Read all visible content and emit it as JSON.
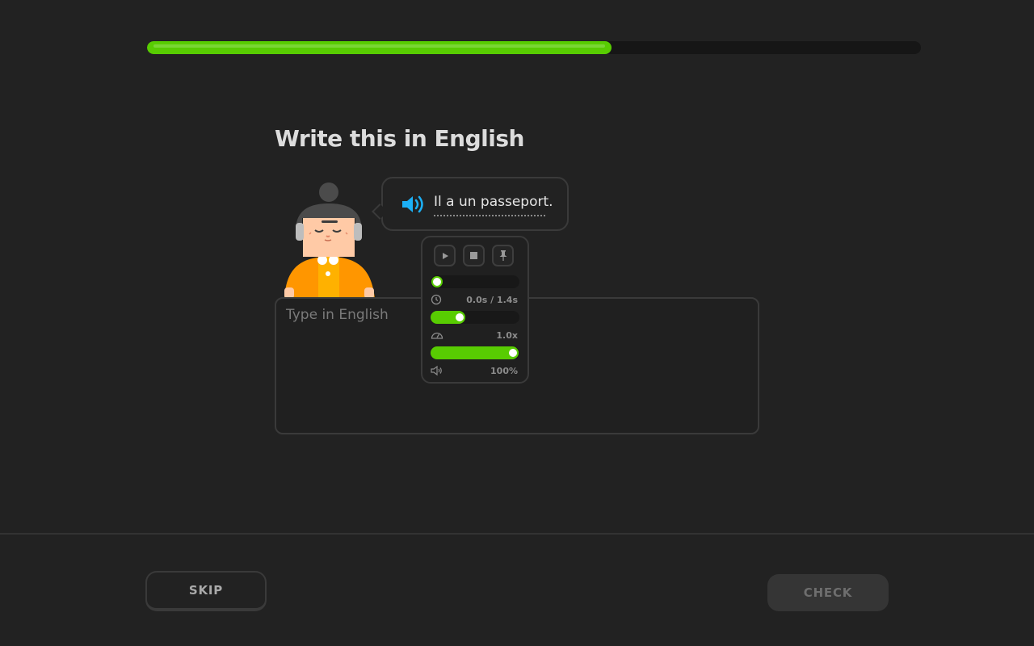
{
  "progress": {
    "fraction": 0.6,
    "color": "#58cc02"
  },
  "lesson": {
    "title": "Write this in English",
    "prompt": "Il a un passeport.",
    "speaker_icon": "speaker-icon",
    "answer_placeholder": "Type in English",
    "answer_value": ""
  },
  "audio_controls": {
    "buttons": [
      {
        "name": "play",
        "icon": "play-icon"
      },
      {
        "name": "stop",
        "icon": "stop-icon"
      },
      {
        "name": "pin",
        "icon": "pin-icon"
      }
    ],
    "position": {
      "value_label": "0.0s / 1.4s",
      "fraction": 0.0,
      "icon": "clock-icon"
    },
    "speed": {
      "value_label": "1.0x",
      "fraction": 0.33,
      "icon": "speedometer-icon"
    },
    "volume": {
      "value_label": "100%",
      "fraction": 1.0,
      "icon": "volume-icon"
    }
  },
  "footer": {
    "skip_label": "SKIP",
    "check_label": "CHECK"
  },
  "colors": {
    "accent": "#58cc02",
    "background": "#222222",
    "speaker": "#1cb0f6"
  }
}
